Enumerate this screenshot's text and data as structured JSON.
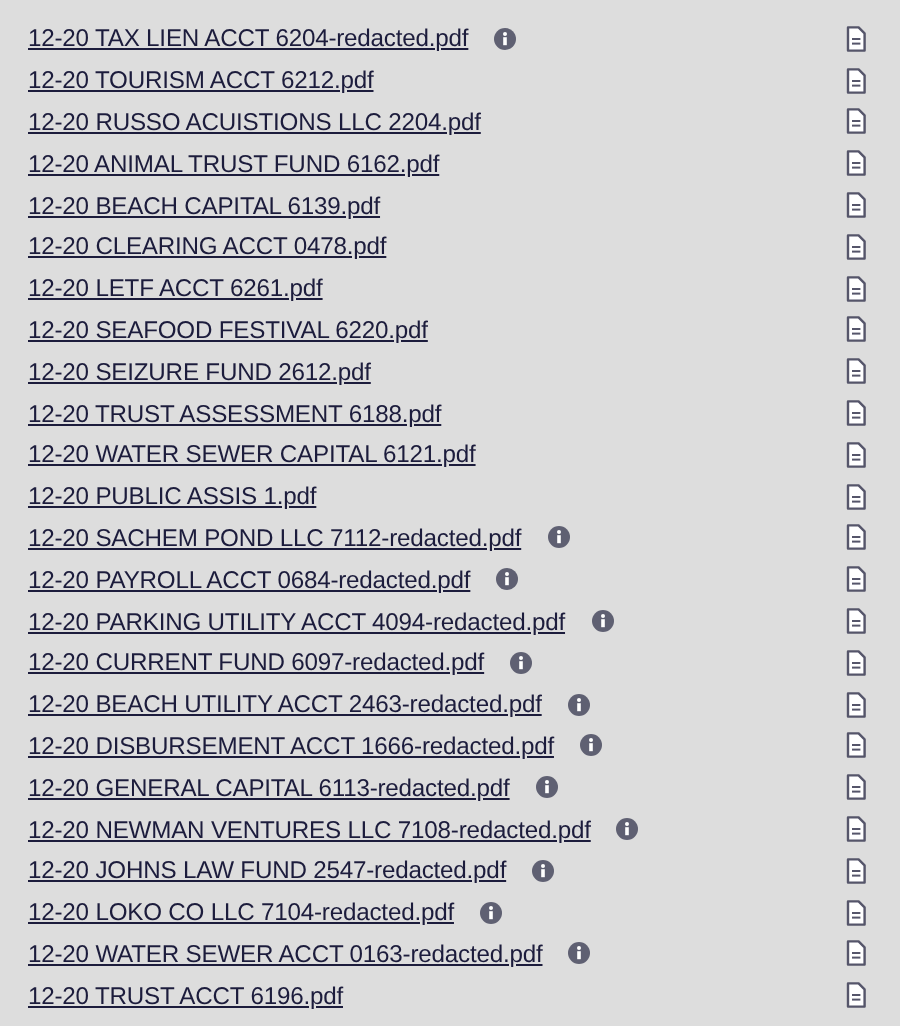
{
  "files": [
    {
      "name": "12-20 TAX LIEN ACCT 6204-redacted.pdf",
      "info": true
    },
    {
      "name": "12-20 TOURISM ACCT 6212.pdf",
      "info": false
    },
    {
      "name": "12-20 RUSSO ACUISTIONS LLC 2204.pdf",
      "info": false
    },
    {
      "name": "12-20 ANIMAL TRUST FUND 6162.pdf",
      "info": false
    },
    {
      "name": "12-20 BEACH CAPITAL 6139.pdf",
      "info": false
    },
    {
      "name": "12-20 CLEARING ACCT 0478.pdf",
      "info": false
    },
    {
      "name": "12-20 LETF ACCT 6261.pdf",
      "info": false
    },
    {
      "name": "12-20 SEAFOOD FESTIVAL 6220.pdf",
      "info": false
    },
    {
      "name": "12-20 SEIZURE FUND 2612.pdf",
      "info": false
    },
    {
      "name": "12-20 TRUST ASSESSMENT 6188.pdf",
      "info": false
    },
    {
      "name": "12-20 WATER SEWER CAPITAL 6121.pdf",
      "info": false
    },
    {
      "name": "12-20 PUBLIC ASSIS 1.pdf",
      "info": false
    },
    {
      "name": "12-20 SACHEM POND LLC 7112-redacted.pdf",
      "info": true
    },
    {
      "name": "12-20 PAYROLL ACCT 0684-redacted.pdf",
      "info": true
    },
    {
      "name": "12-20 PARKING UTILITY ACCT 4094-redacted.pdf",
      "info": true
    },
    {
      "name": "12-20 CURRENT FUND 6097-redacted.pdf",
      "info": true
    },
    {
      "name": "12-20 BEACH UTILITY ACCT 2463-redacted.pdf",
      "info": true
    },
    {
      "name": "12-20 DISBURSEMENT ACCT 1666-redacted.pdf",
      "info": true
    },
    {
      "name": "12-20 GENERAL CAPITAL 6113-redacted.pdf",
      "info": true
    },
    {
      "name": "12-20 NEWMAN VENTURES LLC 7108-redacted.pdf",
      "info": true
    },
    {
      "name": "12-20 JOHNS LAW FUND 2547-redacted.pdf",
      "info": true
    },
    {
      "name": "12-20 LOKO CO LLC 7104-redacted.pdf",
      "info": true
    },
    {
      "name": "12-20 WATER SEWER ACCT 0163-redacted.pdf",
      "info": true
    },
    {
      "name": "12-20 TRUST ACCT 6196.pdf",
      "info": false
    }
  ]
}
